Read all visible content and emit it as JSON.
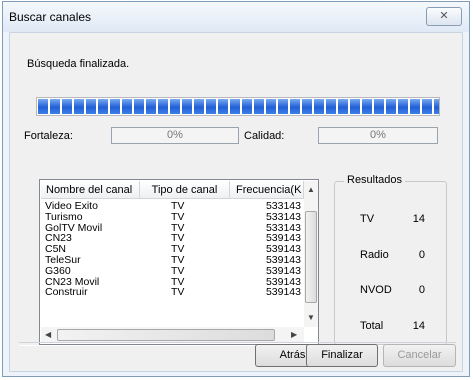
{
  "window": {
    "title": "Buscar canales",
    "close_label": "✕"
  },
  "status": {
    "text": "Búsqueda finalizada."
  },
  "progress": {
    "percent": 100
  },
  "signal": {
    "strength_label": "Fortaleza:",
    "strength_value": "0%",
    "quality_label": "Calidad:",
    "quality_value": "0%"
  },
  "channels": {
    "columns": [
      "Nombre del canal",
      "Tipo de canal",
      "Frecuencia(K"
    ],
    "rows": [
      [
        "Video Exito",
        "TV",
        "533143"
      ],
      [
        "Turismo",
        "TV",
        "533143"
      ],
      [
        "GolTV Movil",
        "TV",
        "533143"
      ],
      [
        "CN23",
        "TV",
        "539143"
      ],
      [
        "C5N",
        "TV",
        "539143"
      ],
      [
        "TeleSur",
        "TV",
        "539143"
      ],
      [
        "G360",
        "TV",
        "539143"
      ],
      [
        "CN23 Movil",
        "TV",
        "539143"
      ],
      [
        "Construir",
        "TV",
        "539143"
      ]
    ]
  },
  "results": {
    "title": "Resultados",
    "items": [
      {
        "label": "TV",
        "value": "14"
      },
      {
        "label": "Radio",
        "value": "0"
      },
      {
        "label": "NVOD",
        "value": "0"
      },
      {
        "label": "Total",
        "value": "14"
      }
    ]
  },
  "buttons": {
    "back": "Atrás",
    "finish": "Finalizar",
    "cancel": "Cancelar"
  },
  "icons": {
    "scroll_up": "scroll-up-arrow",
    "scroll_down": "scroll-down-arrow",
    "scroll_left": "scroll-left-arrow",
    "scroll_right": "scroll-right-arrow"
  }
}
